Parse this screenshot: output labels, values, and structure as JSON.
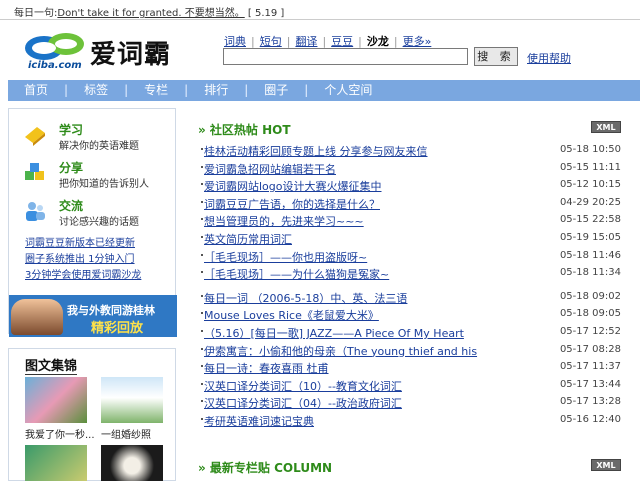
{
  "top": {
    "prefix": "每日一句:",
    "daily": "Don't take it for granted. 不要想当然。",
    "date": "[ 5.19 ]"
  },
  "logo": {
    "brand": "爱词霸",
    "domain": "iciba.com"
  },
  "dict_nav": [
    "词典",
    "短句",
    "翻译",
    "豆豆",
    "沙龙",
    "更多»"
  ],
  "dict_nav_active": "沙龙",
  "search": {
    "button": "搜 索",
    "help": "使用帮助"
  },
  "main_nav": [
    "首页",
    "标签",
    "专栏",
    "排行",
    "圈子",
    "个人空间"
  ],
  "sidebar": {
    "features": [
      {
        "title": "学习",
        "desc": "解决你的英语难题",
        "icon": "book-icon"
      },
      {
        "title": "分享",
        "desc": "把你知道的告诉别人",
        "icon": "cubes-icon"
      },
      {
        "title": "交流",
        "desc": "讨论感兴趣的话题",
        "icon": "people-icon"
      }
    ],
    "links": [
      "词霸豆豆新版本已经更新",
      "圈子系统推出 1分钟入门",
      "3分钟学会使用爱词霸沙龙"
    ],
    "banner": {
      "line1": "我与外教同游桂林",
      "line2": "精彩回放"
    },
    "gallery": {
      "title": "图文集锦",
      "items": [
        {
          "caption": "我爱了你一秒..."
        },
        {
          "caption": "一组婚纱照"
        }
      ]
    }
  },
  "hot": {
    "title": "» 社区热帖 HOT",
    "xml": "XML",
    "items": [
      {
        "title": "桂林活动精彩回顾专题上线 分享参与网友来信",
        "date": "05-18 10:50"
      },
      {
        "title": "爱词霸急招网站编辑若干名",
        "date": "05-15 11:11"
      },
      {
        "title": "爱词霸网站logo设计大赛火爆征集中",
        "date": "05-12 10:15"
      },
      {
        "title": "词霸豆豆广告语，你的选择是什么？",
        "date": "04-29 20:25"
      },
      {
        "title": "想当管理员的，先进来学习~~~",
        "date": "05-15 22:58"
      },
      {
        "title": "英文简历常用词汇",
        "date": "05-19 15:05"
      },
      {
        "title": "［毛毛现场］——你也用盗版呀~",
        "date": "05-18 11:46"
      },
      {
        "title": "［毛毛现场］——为什么猫狗是冤家~",
        "date": "05-18 11:34"
      }
    ],
    "items2": [
      {
        "title": "每日一词 （2006-5-18）中、英、法三语",
        "date": "05-18 09:02"
      },
      {
        "title": "Mouse Loves Rice《老鼠爱大米》",
        "date": "05-18 09:05"
      },
      {
        "title": "（5.16）[每日一歌] JAZZ——A Piece Of My Heart",
        "date": "05-17 12:52"
      },
      {
        "title": "伊索寓言：小偷和他的母亲（The young thief and his",
        "date": "05-17 08:28"
      },
      {
        "title": "每日一诗：春夜喜雨 杜甫",
        "date": "05-17 11:37"
      },
      {
        "title": "汉英口译分类词汇（10）--教育文化词汇",
        "date": "05-17 13:44"
      },
      {
        "title": "汉英口译分类词汇（04）--政治政府词汇",
        "date": "05-17 13:28"
      },
      {
        "title": "考研英语难词速记宝典",
        "date": "05-16 12:40"
      }
    ]
  },
  "column": {
    "title": "» 最新专栏贴 COLUMN",
    "xml": "XML"
  }
}
